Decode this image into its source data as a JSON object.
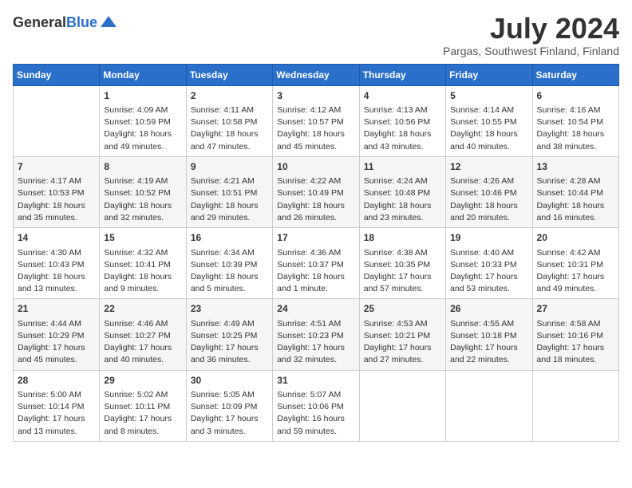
{
  "header": {
    "logo_general": "General",
    "logo_blue": "Blue",
    "month_year": "July 2024",
    "location": "Pargas, Southwest Finland, Finland"
  },
  "days_of_week": [
    "Sunday",
    "Monday",
    "Tuesday",
    "Wednesday",
    "Thursday",
    "Friday",
    "Saturday"
  ],
  "weeks": [
    [
      {
        "day": "",
        "content": ""
      },
      {
        "day": "1",
        "content": "Sunrise: 4:09 AM\nSunset: 10:59 PM\nDaylight: 18 hours\nand 49 minutes."
      },
      {
        "day": "2",
        "content": "Sunrise: 4:11 AM\nSunset: 10:58 PM\nDaylight: 18 hours\nand 47 minutes."
      },
      {
        "day": "3",
        "content": "Sunrise: 4:12 AM\nSunset: 10:57 PM\nDaylight: 18 hours\nand 45 minutes."
      },
      {
        "day": "4",
        "content": "Sunrise: 4:13 AM\nSunset: 10:56 PM\nDaylight: 18 hours\nand 43 minutes."
      },
      {
        "day": "5",
        "content": "Sunrise: 4:14 AM\nSunset: 10:55 PM\nDaylight: 18 hours\nand 40 minutes."
      },
      {
        "day": "6",
        "content": "Sunrise: 4:16 AM\nSunset: 10:54 PM\nDaylight: 18 hours\nand 38 minutes."
      }
    ],
    [
      {
        "day": "7",
        "content": "Sunrise: 4:17 AM\nSunset: 10:53 PM\nDaylight: 18 hours\nand 35 minutes."
      },
      {
        "day": "8",
        "content": "Sunrise: 4:19 AM\nSunset: 10:52 PM\nDaylight: 18 hours\nand 32 minutes."
      },
      {
        "day": "9",
        "content": "Sunrise: 4:21 AM\nSunset: 10:51 PM\nDaylight: 18 hours\nand 29 minutes."
      },
      {
        "day": "10",
        "content": "Sunrise: 4:22 AM\nSunset: 10:49 PM\nDaylight: 18 hours\nand 26 minutes."
      },
      {
        "day": "11",
        "content": "Sunrise: 4:24 AM\nSunset: 10:48 PM\nDaylight: 18 hours\nand 23 minutes."
      },
      {
        "day": "12",
        "content": "Sunrise: 4:26 AM\nSunset: 10:46 PM\nDaylight: 18 hours\nand 20 minutes."
      },
      {
        "day": "13",
        "content": "Sunrise: 4:28 AM\nSunset: 10:44 PM\nDaylight: 18 hours\nand 16 minutes."
      }
    ],
    [
      {
        "day": "14",
        "content": "Sunrise: 4:30 AM\nSunset: 10:43 PM\nDaylight: 18 hours\nand 13 minutes."
      },
      {
        "day": "15",
        "content": "Sunrise: 4:32 AM\nSunset: 10:41 PM\nDaylight: 18 hours\nand 9 minutes."
      },
      {
        "day": "16",
        "content": "Sunrise: 4:34 AM\nSunset: 10:39 PM\nDaylight: 18 hours\nand 5 minutes."
      },
      {
        "day": "17",
        "content": "Sunrise: 4:36 AM\nSunset: 10:37 PM\nDaylight: 18 hours\nand 1 minute."
      },
      {
        "day": "18",
        "content": "Sunrise: 4:38 AM\nSunset: 10:35 PM\nDaylight: 17 hours\nand 57 minutes."
      },
      {
        "day": "19",
        "content": "Sunrise: 4:40 AM\nSunset: 10:33 PM\nDaylight: 17 hours\nand 53 minutes."
      },
      {
        "day": "20",
        "content": "Sunrise: 4:42 AM\nSunset: 10:31 PM\nDaylight: 17 hours\nand 49 minutes."
      }
    ],
    [
      {
        "day": "21",
        "content": "Sunrise: 4:44 AM\nSunset: 10:29 PM\nDaylight: 17 hours\nand 45 minutes."
      },
      {
        "day": "22",
        "content": "Sunrise: 4:46 AM\nSunset: 10:27 PM\nDaylight: 17 hours\nand 40 minutes."
      },
      {
        "day": "23",
        "content": "Sunrise: 4:49 AM\nSunset: 10:25 PM\nDaylight: 17 hours\nand 36 minutes."
      },
      {
        "day": "24",
        "content": "Sunrise: 4:51 AM\nSunset: 10:23 PM\nDaylight: 17 hours\nand 32 minutes."
      },
      {
        "day": "25",
        "content": "Sunrise: 4:53 AM\nSunset: 10:21 PM\nDaylight: 17 hours\nand 27 minutes."
      },
      {
        "day": "26",
        "content": "Sunrise: 4:55 AM\nSunset: 10:18 PM\nDaylight: 17 hours\nand 22 minutes."
      },
      {
        "day": "27",
        "content": "Sunrise: 4:58 AM\nSunset: 10:16 PM\nDaylight: 17 hours\nand 18 minutes."
      }
    ],
    [
      {
        "day": "28",
        "content": "Sunrise: 5:00 AM\nSunset: 10:14 PM\nDaylight: 17 hours\nand 13 minutes."
      },
      {
        "day": "29",
        "content": "Sunrise: 5:02 AM\nSunset: 10:11 PM\nDaylight: 17 hours\nand 8 minutes."
      },
      {
        "day": "30",
        "content": "Sunrise: 5:05 AM\nSunset: 10:09 PM\nDaylight: 17 hours\nand 3 minutes."
      },
      {
        "day": "31",
        "content": "Sunrise: 5:07 AM\nSunset: 10:06 PM\nDaylight: 16 hours\nand 59 minutes."
      },
      {
        "day": "",
        "content": ""
      },
      {
        "day": "",
        "content": ""
      },
      {
        "day": "",
        "content": ""
      }
    ]
  ]
}
